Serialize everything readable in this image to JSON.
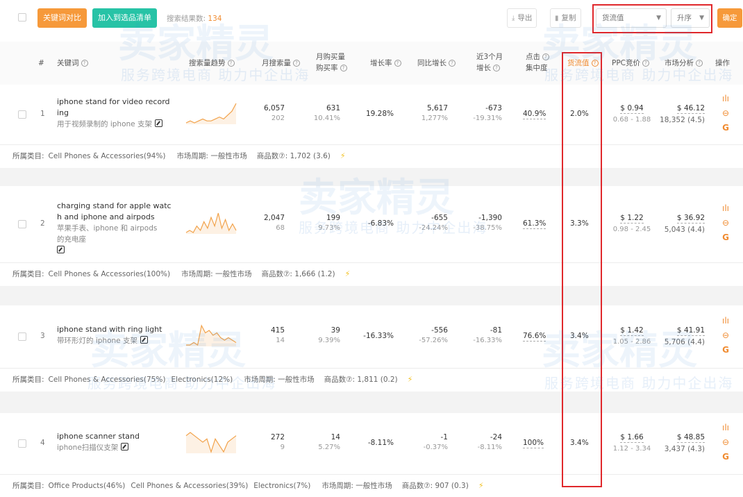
{
  "toolbar": {
    "compare_label": "关键词对比",
    "add_label": "加入到选品清单",
    "count_label": "搜索结果数:",
    "count_value": "134",
    "export_label": "导出",
    "copy_label": "复制",
    "sort_field": "货流值",
    "sort_order": "升序",
    "confirm_label": "确定"
  },
  "header": {
    "index": "#",
    "keyword": "关键词",
    "trend": "搜索量趋势",
    "monthly_search": "月搜索量",
    "monthly_buy_l1": "月购买量",
    "monthly_buy_l2": "购买率",
    "growth": "增长率",
    "yoy": "同比增长",
    "recent_l1": "近3个月",
    "recent_l2": "增长",
    "click_l1": "点击",
    "click_l2": "集中度",
    "flow": "货流值",
    "ppc": "PPC竞价",
    "market": "市场分析",
    "ops": "操作"
  },
  "rows": [
    {
      "index": "1",
      "kw_l1": "iphone stand for video record",
      "kw_l2": "ing",
      "kw_cn": "用于视频录制的 iphone 支架",
      "kw_cn2": "",
      "search": "6,057",
      "search_sub": "202",
      "buy": "631",
      "buy_rate": "10.41%",
      "growth": "19.28%",
      "yoy": "5,617",
      "yoy_sub": "1,277%",
      "recent": "-673",
      "recent_sub": "-19.31%",
      "click": "40.9%",
      "flow": "2.0%",
      "ppc": "$ 0.94",
      "ppc_range": "0.68 - 1.88",
      "market": "$ 46.12",
      "market_sub": "18,352 (4.5)",
      "trend": [
        2,
        3,
        2,
        3,
        4,
        3,
        3,
        4,
        5,
        4,
        6,
        8,
        12
      ]
    },
    {
      "index": "2",
      "kw_l1": "charging stand for apple watc",
      "kw_l2": "h and iphone and airpods",
      "kw_cn": "苹果手表、iphone 和 airpods",
      "kw_cn2": "的充电座",
      "search": "2,047",
      "search_sub": "68",
      "buy": "199",
      "buy_rate": "9.73%",
      "growth": "-6.83%",
      "yoy": "-655",
      "yoy_sub": "-24.24%",
      "recent": "-1,390",
      "recent_sub": "-38.75%",
      "click": "61.3%",
      "flow": "3.3%",
      "ppc": "$ 1.22",
      "ppc_range": "0.98 - 2.45",
      "market": "$ 36.92",
      "market_sub": "5,043 (4.4)",
      "trend": [
        2,
        3,
        2,
        5,
        3,
        7,
        4,
        9,
        5,
        11,
        4,
        8,
        3,
        6,
        3
      ]
    },
    {
      "index": "3",
      "kw_l1": "iphone stand with ring light",
      "kw_l2": "",
      "kw_cn": "带环形灯的 iphone 支架",
      "kw_cn2": "",
      "search": "415",
      "search_sub": "14",
      "buy": "39",
      "buy_rate": "9.39%",
      "growth": "-16.33%",
      "yoy": "-556",
      "yoy_sub": "-57.26%",
      "recent": "-81",
      "recent_sub": "-16.33%",
      "click": "76.6%",
      "flow": "3.4%",
      "ppc": "$ 1.42",
      "ppc_range": "1.05 - 2.86",
      "market": "$ 41.91",
      "market_sub": "5,706 (4.4)",
      "trend": [
        1,
        1,
        2,
        1,
        9,
        6,
        7,
        5,
        6,
        4,
        3,
        4,
        3,
        2
      ]
    },
    {
      "index": "4",
      "kw_l1": "iphone scanner stand",
      "kw_l2": "",
      "kw_cn": "iphone扫描仪支架",
      "kw_cn2": "",
      "search": "272",
      "search_sub": "9",
      "buy": "14",
      "buy_rate": "5.27%",
      "growth": "-8.11%",
      "yoy": "-1",
      "yoy_sub": "-0.37%",
      "recent": "-24",
      "recent_sub": "-8.11%",
      "click": "100%",
      "flow": "3.4%",
      "ppc": "$ 1.66",
      "ppc_range": "1.12 - 3.34",
      "market": "$ 48.85",
      "market_sub": "3,437 (4.3)",
      "trend": [
        7,
        8,
        7,
        6,
        5,
        6,
        2,
        6,
        4,
        2,
        5,
        6,
        7
      ]
    }
  ],
  "categories": [
    {
      "label": "所属类目:",
      "items": [
        "Cell Phones & Accessories(94%)"
      ],
      "cycle": "市场周期: 一般性市场",
      "products": "商品数⑦: 1,702 (3.6)"
    },
    {
      "label": "所属类目:",
      "items": [
        "Cell Phones & Accessories(100%)"
      ],
      "cycle": "市场周期: 一般性市场",
      "products": "商品数⑦: 1,666 (1.2)"
    },
    {
      "label": "所属类目:",
      "items": [
        "Cell Phones & Accessories(75%)",
        "Electronics(12%)"
      ],
      "cycle": "市场周期: 一般性市场",
      "products": "商品数⑦: 1,811 (0.2)"
    },
    {
      "label": "所属类目:",
      "items": [
        "Office Products(46%)",
        "Cell Phones & Accessories(39%)",
        "Electronics(7%)"
      ],
      "cycle": "市场周期: 一般性市场",
      "products": "商品数⑦: 907 (0.3)"
    }
  ],
  "watermark": {
    "brand": "卖家精灵",
    "slogan": "服务跨境电商 助力中企出海"
  },
  "colors": {
    "accent": "#f6993a",
    "green": "#27c3a6",
    "highlight": "#e0272b",
    "spark": "#f2a24a"
  }
}
